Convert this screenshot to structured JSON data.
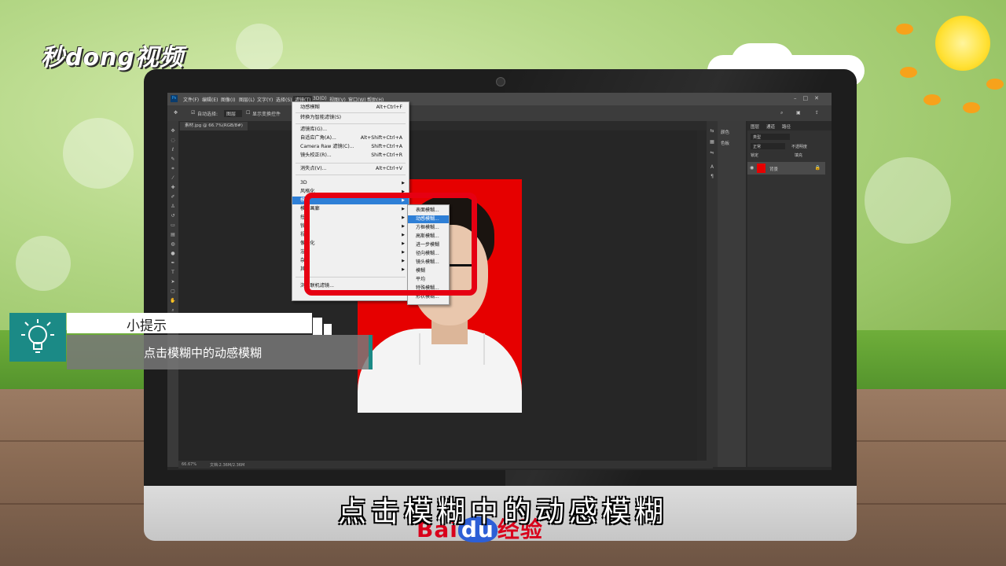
{
  "brand": {
    "logo_text": "秒dong视频"
  },
  "photoshop": {
    "app_icon": "Ps",
    "menubar": [
      "文件(F)",
      "编辑(E)",
      "图像(I)",
      "图层(L)",
      "文字(Y)",
      "选择(S)",
      "滤镜(T)",
      "3D(D)",
      "视图(V)",
      "窗口(W)",
      "帮助(H)"
    ],
    "active_menu": "滤镜(T)",
    "options": {
      "auto_select": "自动选择:",
      "auto_select_value": "图层",
      "show_transform": "显示变换控件"
    },
    "document_tab": "素材.jpg @ 66.7%(RGB/8#)",
    "status": {
      "zoom": "66.67%",
      "doc": "文档:2.36M/2.36M"
    },
    "right_panel": {
      "color": "颜色",
      "swatches": "色板"
    },
    "layers_panel": {
      "tabs": [
        "图层",
        "通道",
        "路径"
      ],
      "kind": "类型",
      "mode": "正常",
      "opacity": "不透明度",
      "lock": "锁定",
      "fill": "填充",
      "layer_name": "背景"
    }
  },
  "filter_menu": {
    "items": [
      {
        "label": "动感模糊",
        "shortcut": "Alt+Ctrl+F"
      },
      {
        "label": "转换为智能滤镜(S)"
      },
      {
        "label": "滤镜库(G)..."
      },
      {
        "label": "自适应广角(A)...",
        "shortcut": "Alt+Shift+Ctrl+A"
      },
      {
        "label": "Camera Raw 滤镜(C)...",
        "shortcut": "Shift+Ctrl+A"
      },
      {
        "label": "镜头校正(R)...",
        "shortcut": "Shift+Ctrl+R"
      },
      {
        "label": "消失点(V)...",
        "shortcut": "Alt+Ctrl+V"
      },
      {
        "label": "3D"
      },
      {
        "label": "风格化"
      },
      {
        "label": "模糊"
      },
      {
        "label": "模糊画廊"
      },
      {
        "label": "扭曲"
      },
      {
        "label": "锐化"
      },
      {
        "label": "视频"
      },
      {
        "label": "像素化"
      },
      {
        "label": "渲染"
      },
      {
        "label": "杂色"
      },
      {
        "label": "其它"
      },
      {
        "label": "浏览联机滤镜..."
      }
    ],
    "highlighted": "模糊"
  },
  "blur_submenu": {
    "items": [
      "表面模糊...",
      "动感模糊...",
      "方框模糊...",
      "高斯模糊...",
      "进一步模糊",
      "径向模糊...",
      "镜头模糊...",
      "模糊",
      "平均",
      "特殊模糊...",
      "形状模糊..."
    ],
    "highlighted": "动感模糊..."
  },
  "tip": {
    "heading": "小提示",
    "text": "点击模糊中的动感模糊"
  },
  "subtitle": "点击模糊中的动感模糊",
  "watermark": {
    "text1": "Bai",
    "text2": "du",
    "text3": "经验"
  },
  "colors": {
    "highlight": "#2e7fd6",
    "red_box": "#e60012",
    "teal": "#1b8a86",
    "photo_bg": "#e60000"
  }
}
